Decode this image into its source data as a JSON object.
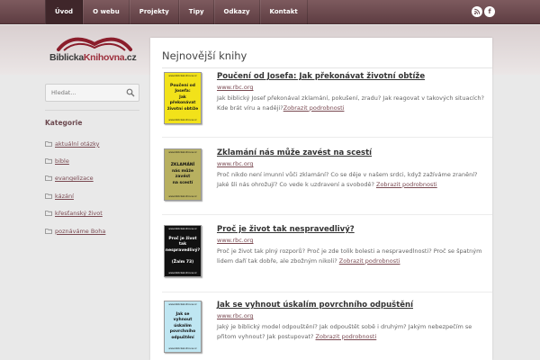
{
  "nav": {
    "items": [
      "Úvod",
      "O webu",
      "Projekty",
      "Tipy",
      "Odkazy",
      "Kontakt"
    ],
    "active_index": 0
  },
  "social": {
    "rss_icon": "rss-icon",
    "facebook_icon": "facebook-icon",
    "facebook_glyph": "f"
  },
  "logo": {
    "part1": "Biblicka",
    "part2": "Knihovna",
    "part3": ".cz",
    "icon": "open-book-icon"
  },
  "search": {
    "placeholder": "Hledat...",
    "icon": "search-icon"
  },
  "sidebar": {
    "categories_title": "Kategorie",
    "categories": [
      "aktuální otázky",
      "bible",
      "evangelizace",
      "kázání",
      "křesťanský život",
      "poznáváme Boha"
    ]
  },
  "main": {
    "title": "Nejnovější knihy",
    "books": [
      {
        "title": "Poučení od Josefa: Jak překonávat životní obtíže",
        "url": "www.rbc.org",
        "desc": "Jak biblický Josef překonával zklamání, pokušení, zradu? Jak reagovat v takových situacích? Kde brát víru a naději?",
        "more": "Zobrazit podrobnosti",
        "cover_lines": [
          "Poučení od",
          "Josefa:",
          "Jak překonávat",
          "životní obtíže"
        ],
        "cover_bg": "#f2e21a",
        "cover_fg": "#1a1a1a"
      },
      {
        "title": "Zklamání nás může zavést na scestí",
        "url": "www.rbc.org",
        "desc": "Proč nikdo není imunní vůči zklamání? Co se děje v našem srdci, když zažíváme zranění? Jaké šli nás ohrožují? Co vede k uzdravení a svobodě?",
        "more": "Zobrazit podrobnosti",
        "cover_lines": [
          "ZKLAMÁNÍ",
          "nás může zavést",
          "na scestí"
        ],
        "cover_bg": "#b8b060",
        "cover_fg": "#111111"
      },
      {
        "title": "Proč je život tak nespravedlivý?",
        "url": "www.rbc.org",
        "desc": "Proč je život tak plný rozporů? Proč je zde tolik bolesti a nespravedlnosti? Proč se špatným lidem daří tak dobře, ale zbožným nikoli?",
        "more": "Zobrazit podrobnosti",
        "cover_lines": [
          "Proč je život tak",
          "nespravedlivý?",
          "",
          "(Žalm 73)"
        ],
        "cover_bg": "#111111",
        "cover_fg": "#ffffff"
      },
      {
        "title": "Jak se vyhnout úskalím povrchního odpuštění",
        "url": "www.rbc.org",
        "desc": "Jaký je biblický model odpouštění? Jak odpouštět sobě i druhým? Jakým nebezpečím se přitom vyhnout? Jak postupovat?",
        "more": "Zobrazit podrobnosti",
        "cover_lines": [
          "Jak se vyhnout",
          "úskalím",
          "povrchního",
          "odpuštění"
        ],
        "cover_bg": "#bfe6f2",
        "cover_fg": "#111111"
      }
    ],
    "cover_small_text": "www.biblickaknihovna.cz"
  }
}
